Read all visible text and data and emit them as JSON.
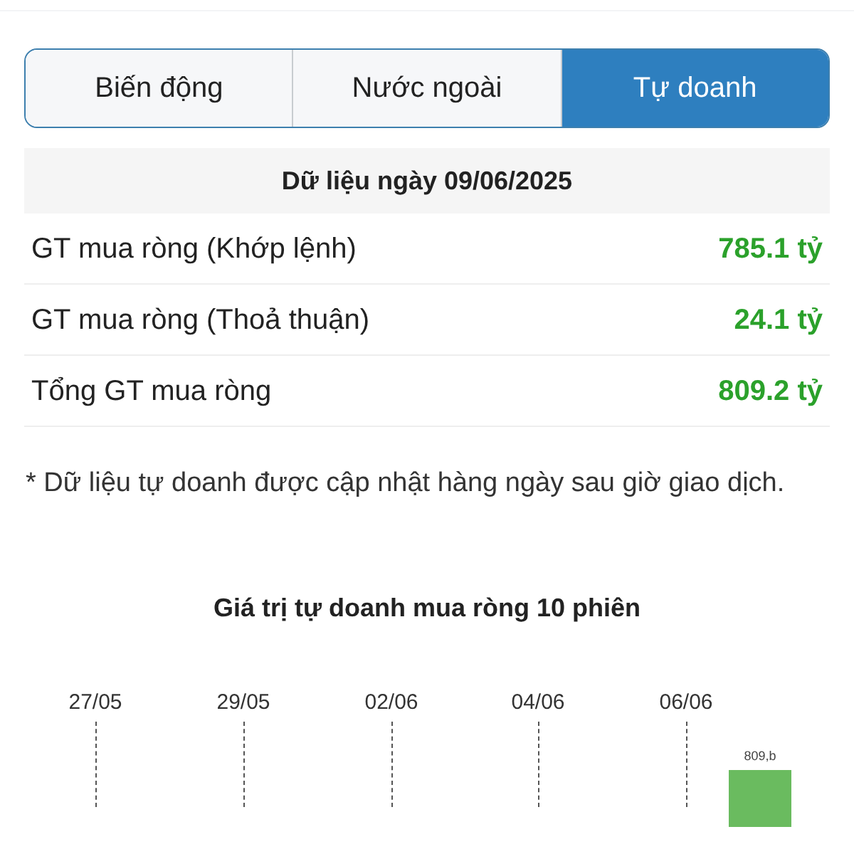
{
  "tabs": [
    {
      "label": "Biến động",
      "selected": false
    },
    {
      "label": "Nước ngoài",
      "selected": false
    },
    {
      "label": "Tự doanh",
      "selected": true
    }
  ],
  "summary": {
    "header": "Dữ liệu ngày 09/06/2025",
    "rows": [
      {
        "label": "GT mua ròng (Khớp lệnh)",
        "value": "785.1 tỷ"
      },
      {
        "label": "GT mua ròng (Thoả thuận)",
        "value": "24.1 tỷ"
      },
      {
        "label": "Tổng GT mua ròng",
        "value": "809.2 tỷ"
      }
    ]
  },
  "note": "* Dữ liệu tự doanh được cập nhật hàng ngày sau giờ giao dịch.",
  "chart": {
    "title": "Giá trị tự doanh mua ròng 10 phiên",
    "x_labels": [
      "27/05",
      "29/05",
      "02/06",
      "04/06",
      "06/06"
    ],
    "bar_label": "809,b"
  }
}
